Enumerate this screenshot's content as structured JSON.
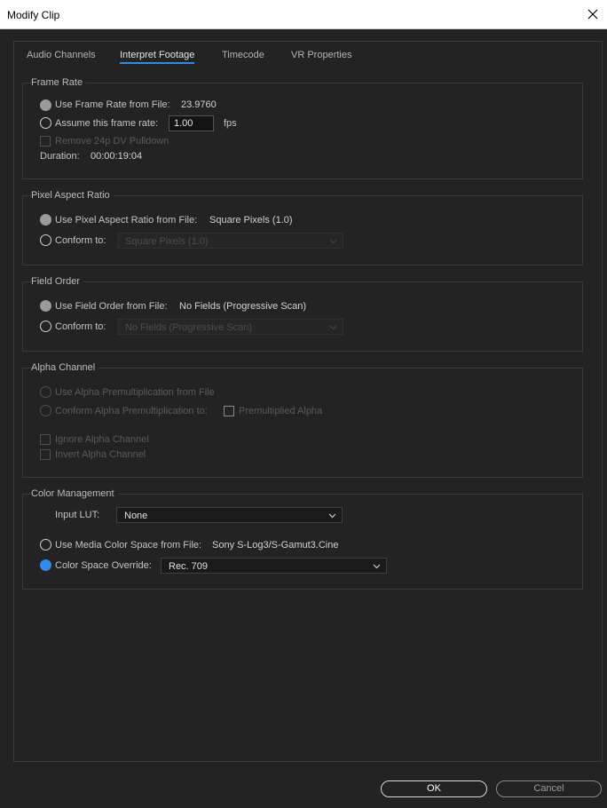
{
  "window": {
    "title": "Modify Clip"
  },
  "tabs": [
    "Audio Channels",
    "Interpret Footage",
    "Timecode",
    "VR Properties"
  ],
  "frame_rate": {
    "legend": "Frame Rate",
    "use_from_file_label": "Use Frame Rate from File:",
    "use_from_file_value": "23.9760",
    "assume_label": "Assume this frame rate:",
    "assume_value": "1.00",
    "fps_label": "fps",
    "pulldown_label": "Remove 24p DV Pulldown",
    "duration_label": "Duration:",
    "duration_value": "00:00:19:04"
  },
  "pixel_aspect": {
    "legend": "Pixel Aspect Ratio",
    "use_from_file_label": "Use Pixel Aspect Ratio from File:",
    "use_from_file_value": "Square Pixels (1.0)",
    "conform_label": "Conform to:",
    "conform_value": "Square Pixels (1.0)"
  },
  "field_order": {
    "legend": "Field Order",
    "use_from_file_label": "Use Field Order from File:",
    "use_from_file_value": "No Fields (Progressive Scan)",
    "conform_label": "Conform to:",
    "conform_value": "No Fields (Progressive Scan)"
  },
  "alpha": {
    "legend": "Alpha Channel",
    "use_premult_label": "Use Alpha Premultiplication from File",
    "conform_premult_label": "Conform Alpha Premultiplication to:",
    "premultiplied_label": "Premultiplied Alpha",
    "ignore_label": "Ignore Alpha Channel",
    "invert_label": "Invert Alpha Channel"
  },
  "color": {
    "legend": "Color Management",
    "input_lut_label": "Input LUT:",
    "input_lut_value": "None",
    "media_space_label": "Use Media Color Space from File:",
    "media_space_value": "Sony S-Log3/S-Gamut3.Cine",
    "override_label": "Color Space Override:",
    "override_value": "Rec. 709"
  },
  "buttons": {
    "ok": "OK",
    "cancel": "Cancel"
  },
  "colors": {
    "accent": "#2d8ceb",
    "background": "#232323"
  }
}
